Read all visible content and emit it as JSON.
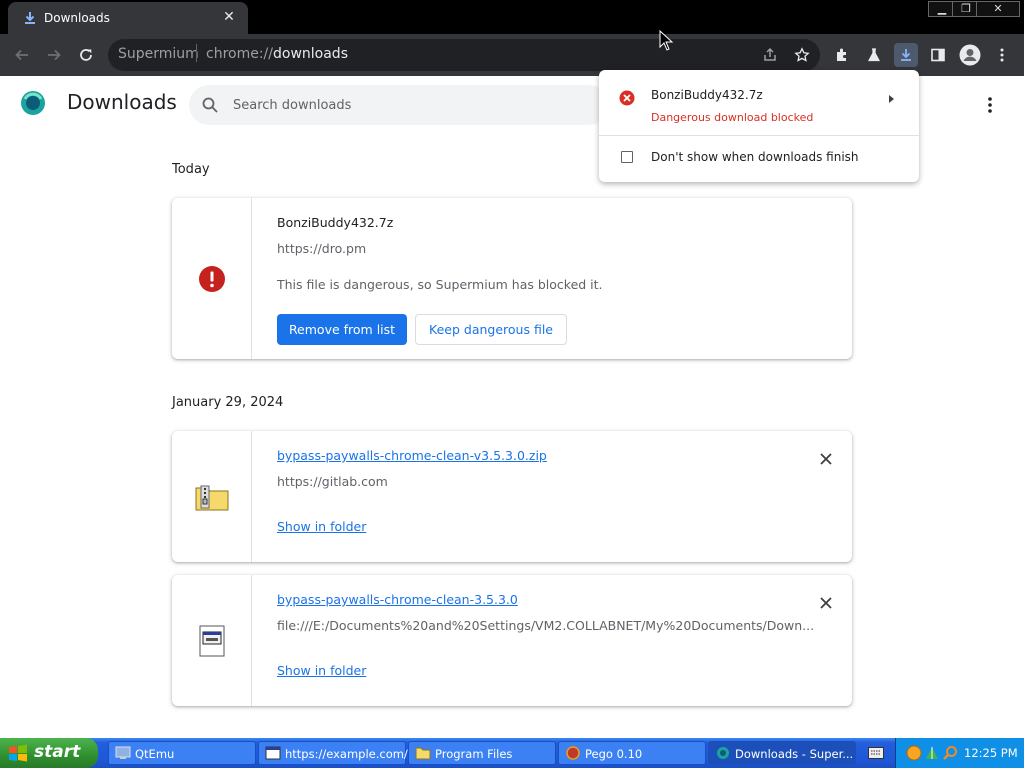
{
  "browser": {
    "tab_title": "Downloads",
    "omnibox_host": "Supermium",
    "omnibox_scheme": "chrome://",
    "omnibox_path": "downloads"
  },
  "page": {
    "title": "Downloads",
    "search_placeholder": "Search downloads"
  },
  "sections": [
    {
      "date": "Today",
      "items": [
        {
          "name": "BonziBuddy432.7z",
          "source": "https://dro.pm",
          "warning": "This file is dangerous, so Supermium has blocked it.",
          "primary_button": "Remove from list",
          "secondary_button": "Keep dangerous file",
          "icon": "error-icon"
        }
      ]
    },
    {
      "date": "January 29, 2024",
      "items": [
        {
          "name": "bypass-paywalls-chrome-clean-v3.5.3.0.zip",
          "source": "https://gitlab.com",
          "action": "Show in folder",
          "icon": "zip-folder-icon"
        },
        {
          "name": "bypass-paywalls-chrome-clean-3.5.3.0",
          "source": "file:///E:/Documents%20and%20Settings/VM2.COLLABNET/My%20Documents/Down...",
          "action": "Show in folder",
          "icon": "exe-file-icon"
        }
      ]
    }
  ],
  "bubble": {
    "file_name": "BonziBuddy432.7z",
    "status": "Dangerous download blocked",
    "checkbox_label": "Don't show when downloads finish",
    "checkbox_checked": false
  },
  "taskbar": {
    "start_label": "start",
    "tasks": [
      {
        "label": "QtEmu"
      },
      {
        "label": "https://example.com/"
      },
      {
        "label": "Program Files"
      },
      {
        "label": "Pego 0.10"
      },
      {
        "label": "Downloads - Super..."
      }
    ],
    "clock": "12:25 PM"
  },
  "colors": {
    "accent": "#1a73e8",
    "danger": "#d93025",
    "chrome_toolbar": "#35363a",
    "taskbar_blue": "#245edb"
  }
}
